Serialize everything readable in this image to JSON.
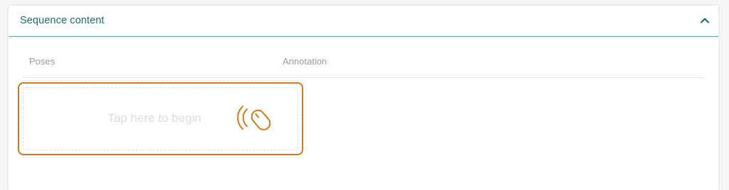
{
  "section": {
    "title": "Sequence content",
    "collapse_icon": "chevron-up-icon"
  },
  "table": {
    "columns": [
      "Poses",
      "Annotation"
    ]
  },
  "placeholder": {
    "text": "Tap here to begin",
    "icon": "tap-mouse-icon"
  },
  "colors": {
    "accent": "#1d6f6d",
    "header_border": "#4fa9b3",
    "highlight": "#cc7a22",
    "muted_text": "#9a9a9a"
  }
}
